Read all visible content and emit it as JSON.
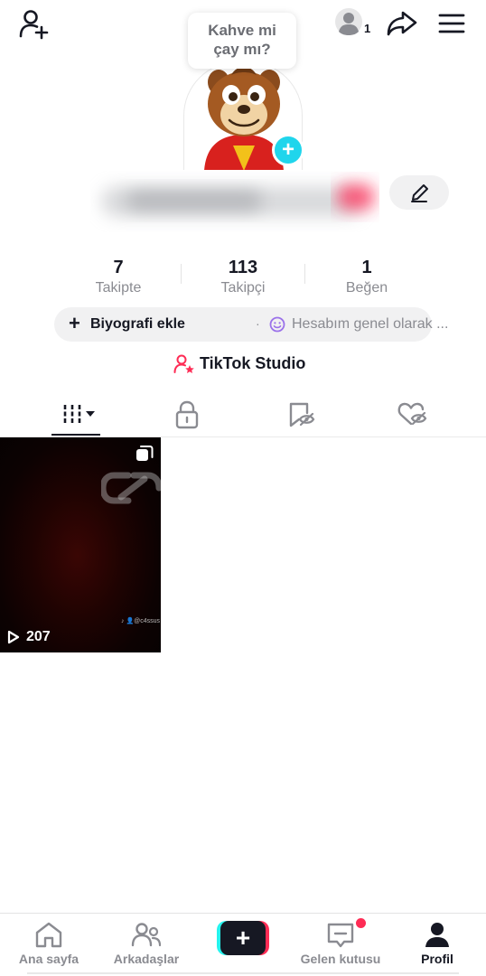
{
  "header": {
    "account_badge": "1",
    "bubble_line1": "Kahve mi",
    "bubble_line2": "çay mı?"
  },
  "profile": {
    "stats": [
      {
        "value": "7",
        "label": "Takipte"
      },
      {
        "value": "113",
        "label": "Takipçi"
      },
      {
        "value": "1",
        "label": "Beğen"
      }
    ],
    "bio_add_label": "Biyografi ekle",
    "bio_separator": "·",
    "bio_status": "Hesabım genel olarak ...",
    "studio_label": "TikTok Studio"
  },
  "tabs": [
    {
      "name": "videos",
      "active": true
    },
    {
      "name": "private",
      "active": false
    },
    {
      "name": "reposts",
      "active": false
    },
    {
      "name": "liked",
      "active": false
    }
  ],
  "videos": [
    {
      "views": "207",
      "watermark": "♪ 👤@c4ssus"
    }
  ],
  "bottom_nav": [
    {
      "label": "Ana sayfa",
      "active": false
    },
    {
      "label": "Arkadaşlar",
      "active": false
    },
    {
      "label": "Gelen kutusu",
      "active": false,
      "badge": true
    },
    {
      "label": "Profil",
      "active": true
    }
  ],
  "colors": {
    "accent_cyan": "#20d5ec",
    "accent_pink": "#fe2c55",
    "text_primary": "#161823",
    "text_secondary": "#8a8b91",
    "pill_bg": "#f1f1f2"
  }
}
